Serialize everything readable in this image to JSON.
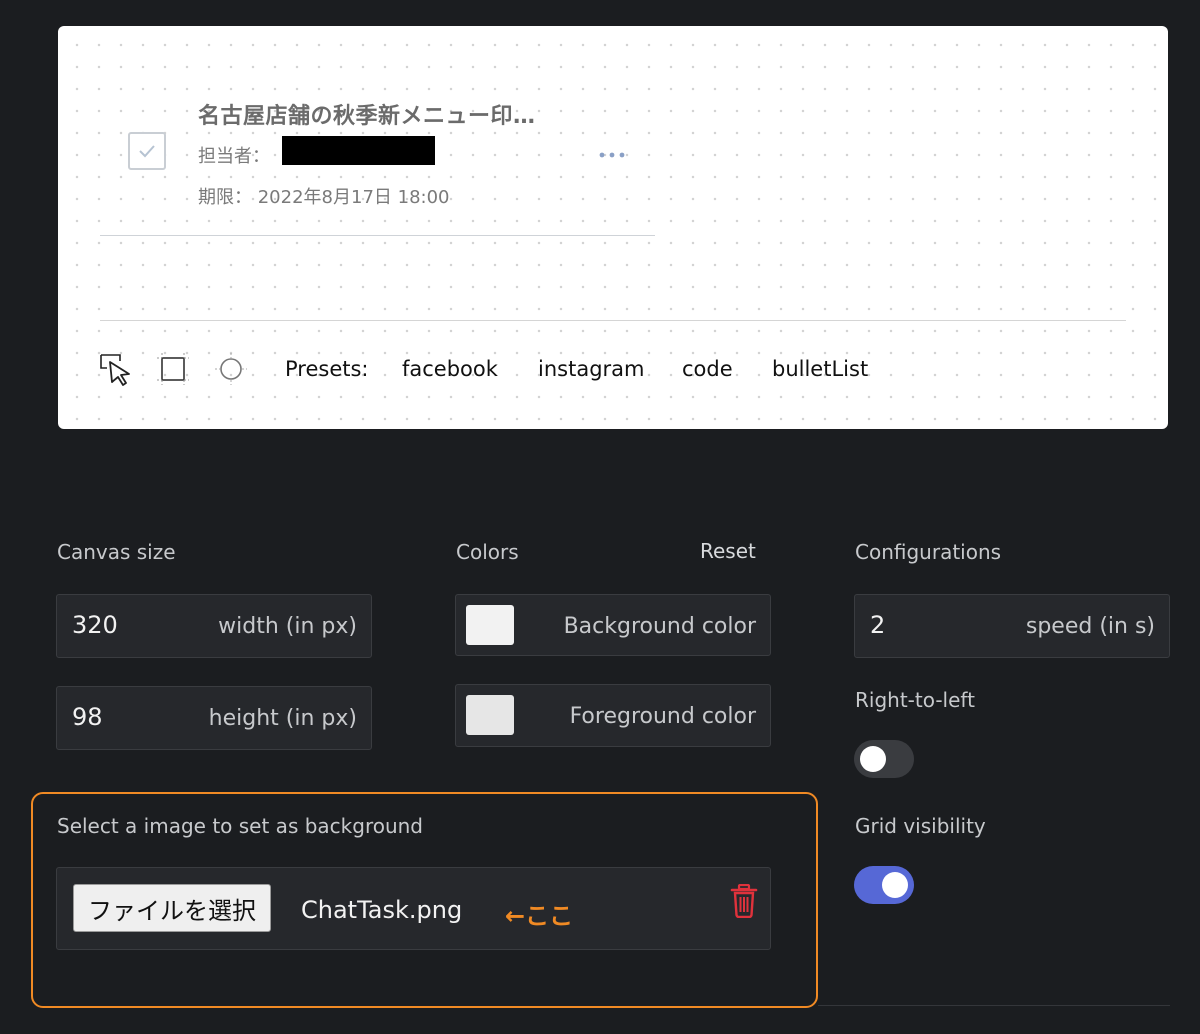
{
  "preview": {
    "task_title": "名古屋店舗の秋季新メニュー印…",
    "assignee_label": "担当者：",
    "due_label": "期限：",
    "due_value": "2022年8月17日 18:00",
    "more_icon": "more-horizontal-icon"
  },
  "toolbar": {
    "tools": [
      "pointer-icon",
      "rectangle-icon",
      "circle-icon"
    ],
    "presets_label": "Presets:",
    "presets": [
      "facebook",
      "instagram",
      "code",
      "bulletList"
    ]
  },
  "canvas_size": {
    "heading": "Canvas size",
    "width_value": "320",
    "width_label": "width (in px)",
    "height_value": "98",
    "height_label": "height (in px)"
  },
  "colors": {
    "heading": "Colors",
    "reset_label": "Reset",
    "background_label": "Background color",
    "background_swatch": "#f2f2f2",
    "foreground_label": "Foreground color",
    "foreground_swatch": "#e6e6e6"
  },
  "configurations": {
    "heading": "Configurations",
    "speed_value": "2",
    "speed_label": "speed (in s)",
    "rtl_label": "Right-to-left",
    "rtl_enabled": false,
    "grid_label": "Grid visibility",
    "grid_enabled": true
  },
  "background_image": {
    "heading": "Select a image to set as background",
    "choose_button": "ファイルを選択",
    "file_name": "ChatTask.png",
    "annotation": "←ここ",
    "delete_icon": "trash-icon"
  },
  "theme": {
    "accent": "#5668d6",
    "highlight": "#f08a24",
    "danger": "#e0323c"
  }
}
